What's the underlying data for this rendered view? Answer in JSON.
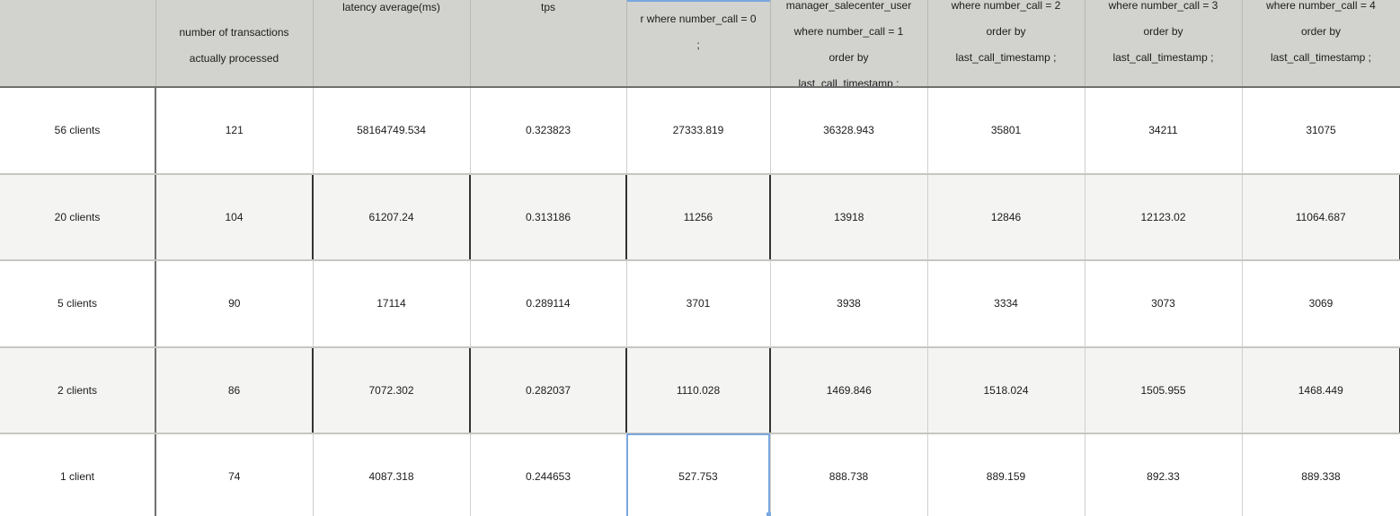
{
  "headers": [
    "",
    "number of transactions actually processed",
    "latency average(ms)",
    "tps",
    "r where number_call = 0 ;",
    "manager_salecenter_user where number_call = 1 order by last_call_timestamp ;",
    "where number_call = 2 order by last_call_timestamp ;",
    "where number_call = 3 order by last_call_timestamp ;",
    "where number_call = 4 order by last_call_timestamp ;"
  ],
  "header_lines": {
    "h1": [
      "number of transactions",
      "actually processed"
    ],
    "h2": [
      "latency average(ms)"
    ],
    "h3": [
      "tps"
    ],
    "h4": [
      "r where number_call = 0",
      ";"
    ],
    "h5": [
      "manager_salecenter_user",
      "where number_call = 1",
      "order by",
      "last_call_timestamp ;"
    ],
    "h6": [
      "where number_call = 2",
      "order by",
      "last_call_timestamp ;"
    ],
    "h7": [
      "where number_call = 3",
      "order by",
      "last_call_timestamp ;"
    ],
    "h8": [
      "where number_call = 4",
      "order by",
      "last_call_timestamp ;"
    ]
  },
  "rows": [
    {
      "label": "56 clients",
      "cells": [
        "121",
        "58164749.534",
        "0.323823",
        "27333.819",
        "36328.943",
        "35801",
        "34211",
        "31075"
      ]
    },
    {
      "label": "20 clients",
      "cells": [
        "104",
        "61207.24",
        "0.313186",
        "11256",
        "13918",
        "12846",
        "12123.02",
        "11064.687"
      ]
    },
    {
      "label": "5 clients",
      "cells": [
        "90",
        "17114",
        "0.289114",
        "3701",
        "3938",
        "3334",
        "3073",
        "3069"
      ]
    },
    {
      "label": "2 clients",
      "cells": [
        "86",
        "7072.302",
        "0.282037",
        "1110.028",
        "1469.846",
        "1518.024",
        "1505.955",
        "1468.449"
      ]
    },
    {
      "label": "1 client",
      "cells": [
        "74",
        "4087.318",
        "0.244653",
        "527.753",
        "888.738",
        "889.159",
        "892.33",
        "889.338"
      ]
    }
  ],
  "selection": {
    "row": 4,
    "column": 4,
    "color": "#7aa7e0"
  },
  "colors": {
    "header_bg": "#d2d2ce",
    "alt_row_bg": "#f4f4f2",
    "selection": "#7aa7e0"
  }
}
